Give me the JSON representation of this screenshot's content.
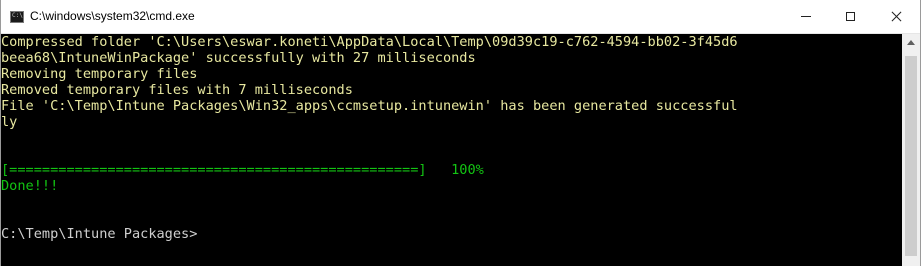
{
  "window": {
    "title": "C:\\windows\\system32\\cmd.exe",
    "icon_text": "C:\\"
  },
  "titlebar_buttons": {
    "minimize": "minimize",
    "maximize": "maximize",
    "close": "close"
  },
  "console": {
    "lines": [
      {
        "text": "Compressed folder 'C:\\Users\\eswar.koneti\\AppData\\Local\\Temp\\09d39c19-c762-4594-bb02-3f45d6",
        "color": "#e8e8a0"
      },
      {
        "text": "beea68\\IntuneWinPackage' successfully with 27 milliseconds",
        "color": "#e8e8a0"
      },
      {
        "text": "Removing temporary files",
        "color": "#e8e8a0"
      },
      {
        "text": "Removed temporary files with 7 milliseconds",
        "color": "#e8e8a0"
      },
      {
        "text": "File 'C:\\Temp\\Intune Packages\\Win32_apps\\ccmsetup.intunewin' has been generated successful",
        "color": "#e8e8a0"
      },
      {
        "text": "ly",
        "color": "#e8e8a0"
      },
      {
        "text": "",
        "color": "#e8e8a0"
      },
      {
        "text": "",
        "color": "#e8e8a0"
      },
      {
        "text": "[==================================================]   100%",
        "color": "#13c413"
      },
      {
        "text": "Done!!!",
        "color": "#13c413"
      },
      {
        "text": "",
        "color": "#cfcfcf"
      },
      {
        "text": "",
        "color": "#cfcfcf"
      },
      {
        "text": "C:\\Temp\\Intune Packages>",
        "color": "#cfcfcf"
      }
    ]
  },
  "colors": {
    "console_background": "#000000",
    "text_yellow": "#e8e8a0",
    "text_green": "#13c413",
    "text_white": "#cfcfcf"
  }
}
